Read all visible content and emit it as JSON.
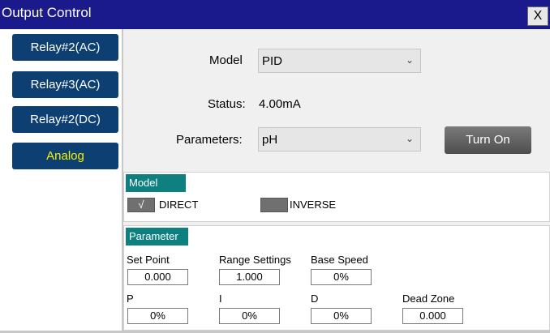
{
  "window": {
    "title": "Output Control",
    "close_label": "X"
  },
  "sidebar": {
    "items": [
      {
        "label": "Relay#2(AC)"
      },
      {
        "label": "Relay#3(AC)"
      },
      {
        "label": "Relay#2(DC)"
      },
      {
        "label": "Analog"
      }
    ]
  },
  "form": {
    "model_label": "Model",
    "model_value": "PID",
    "status_label": "Status:",
    "status_value": "4.00mA",
    "parameters_label": "Parameters:",
    "parameters_value": "pH",
    "turn_on_label": "Turn On"
  },
  "model_section": {
    "header": "Model",
    "direct_label": "DIRECT",
    "direct_check": "√",
    "inverse_label": "INVERSE"
  },
  "parameter_section": {
    "header": "Parameter",
    "set_point": {
      "label": "Set Point",
      "value": "0.000"
    },
    "range_settings": {
      "label": "Range Settings",
      "value": "1.000"
    },
    "base_speed": {
      "label": "Base Speed",
      "value": "0%"
    },
    "p": {
      "label": "P",
      "value": "0%"
    },
    "i": {
      "label": "I",
      "value": "0%"
    },
    "d": {
      "label": "D",
      "value": "0%"
    },
    "dead_zone": {
      "label": "Dead Zone",
      "value": "0.000"
    }
  },
  "colors": {
    "titlebar": "#1a1a8c",
    "nav_button": "#0d3f72",
    "nav_active_text": "#f5f200",
    "section_header": "#0e8080"
  }
}
